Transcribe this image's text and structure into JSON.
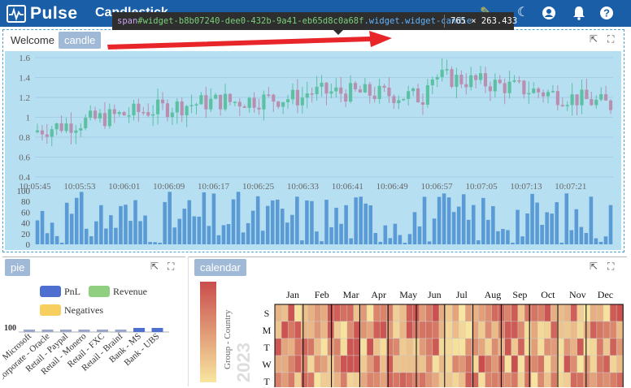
{
  "app": {
    "name": "Pulse",
    "page_title": "Candlestick"
  },
  "toolbar": {
    "icons": [
      "pin-icon",
      "moon-icon",
      "user-icon",
      "bell-icon",
      "help-icon"
    ]
  },
  "inspector": {
    "tag": "span",
    "selector": "#widget-b8b07240-dee0-432b-9a41-eb65d8c0a68f",
    "classes": ".widget.widget-candle",
    "size": "765 × 263.433"
  },
  "candle_panel": {
    "title": "Welcome",
    "tab": "candle",
    "icons": [
      "external-link-icon",
      "expand-icon"
    ]
  },
  "pie_panel": {
    "tab": "pie",
    "legend": [
      "PnL",
      "Revenue",
      "Negatives"
    ],
    "legend_colors": [
      "#4d6fcf",
      "#8fcf7f",
      "#f7cf5f"
    ],
    "categories": [
      "Microsoft",
      "Corporate - Oracle",
      "Retail - Paypal",
      "Retail - Monero",
      "Retail - FXC",
      "Retail - Brainf",
      "Bank - MS",
      "Bank - UBS"
    ],
    "y_tick": "100"
  },
  "cal_panel": {
    "tab": "calendar",
    "year": "2023",
    "visual_map_label": "Group - Country",
    "months": [
      "Jan",
      "Feb",
      "Mar",
      "Apr",
      "May",
      "Jun",
      "Jul",
      "Aug",
      "Sep",
      "Oct",
      "Nov",
      "Dec"
    ],
    "days": [
      "S",
      "M",
      "T",
      "W",
      "T"
    ]
  },
  "chart_data": [
    {
      "type": "candlestick",
      "y_ticks": [
        "1.6",
        "1.4",
        "1.2",
        "1",
        "0.8",
        "0.6",
        "0.4"
      ],
      "ylim": [
        0.4,
        1.6
      ],
      "x_ticks": [
        "10:05:45",
        "10:05:53",
        "10:06:01",
        "10:06:09",
        "10:06:17",
        "10:06:25",
        "10:06:33",
        "10:06:41",
        "10:06:49",
        "10:06:57",
        "10:07:05",
        "10:07:13",
        "10:07:21"
      ],
      "up_color": "#5cc1a2",
      "down_color": "#b98fb0",
      "grid": true
    },
    {
      "type": "bar",
      "y_ticks": [
        "100",
        "80",
        "60",
        "40",
        "20",
        "0"
      ],
      "ylim": [
        0,
        100
      ],
      "color": "#5b9bd5"
    },
    {
      "type": "heatmap",
      "colors": [
        "#f8e6a0",
        "#c94d4d"
      ]
    }
  ]
}
